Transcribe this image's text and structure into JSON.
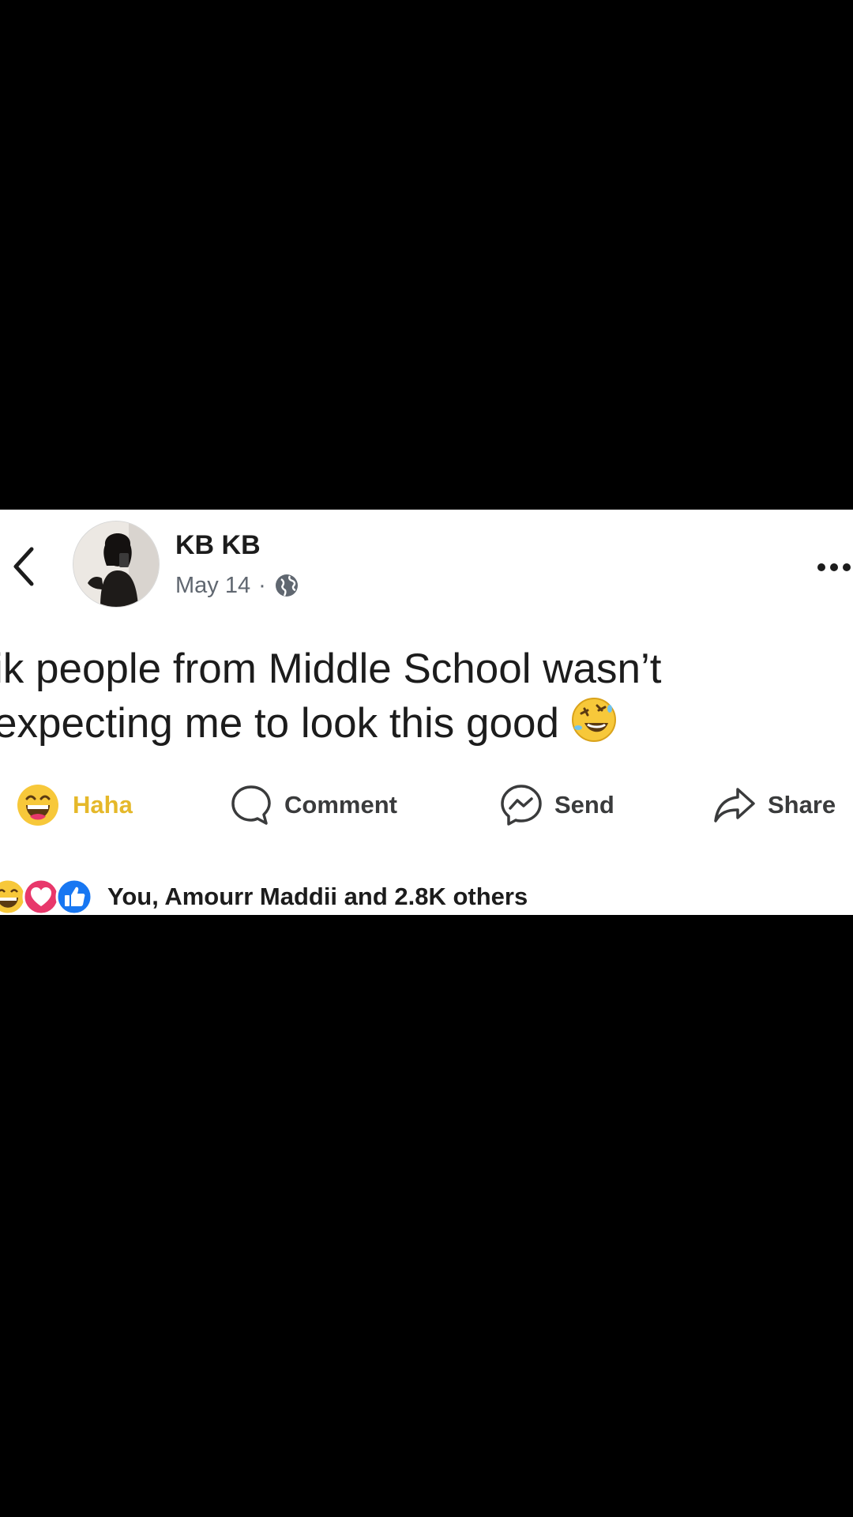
{
  "post": {
    "author": "KB KB",
    "date": "May 14",
    "separator": "·",
    "privacy_icon": "globe-icon",
    "text": "ik people from Middle School wasn’t\nexpecting me to look this good",
    "text_emoji": "rolling-on-floor-laughing-emoji"
  },
  "actions": {
    "haha_label": "Haha",
    "comment_label": "Comment",
    "send_label": "Send",
    "share_label": "Share"
  },
  "reactions": {
    "icons": [
      "haha-icon",
      "love-icon",
      "like-icon"
    ],
    "summary": "You, Amourr Maddii and 2.8K others"
  },
  "colors": {
    "background": "#000000",
    "card": "#ffffff",
    "text": "#1c1c1c",
    "muted": "#606770",
    "haha_accent": "#e5b82a",
    "love": "#e8386b",
    "like": "#1877f2"
  }
}
